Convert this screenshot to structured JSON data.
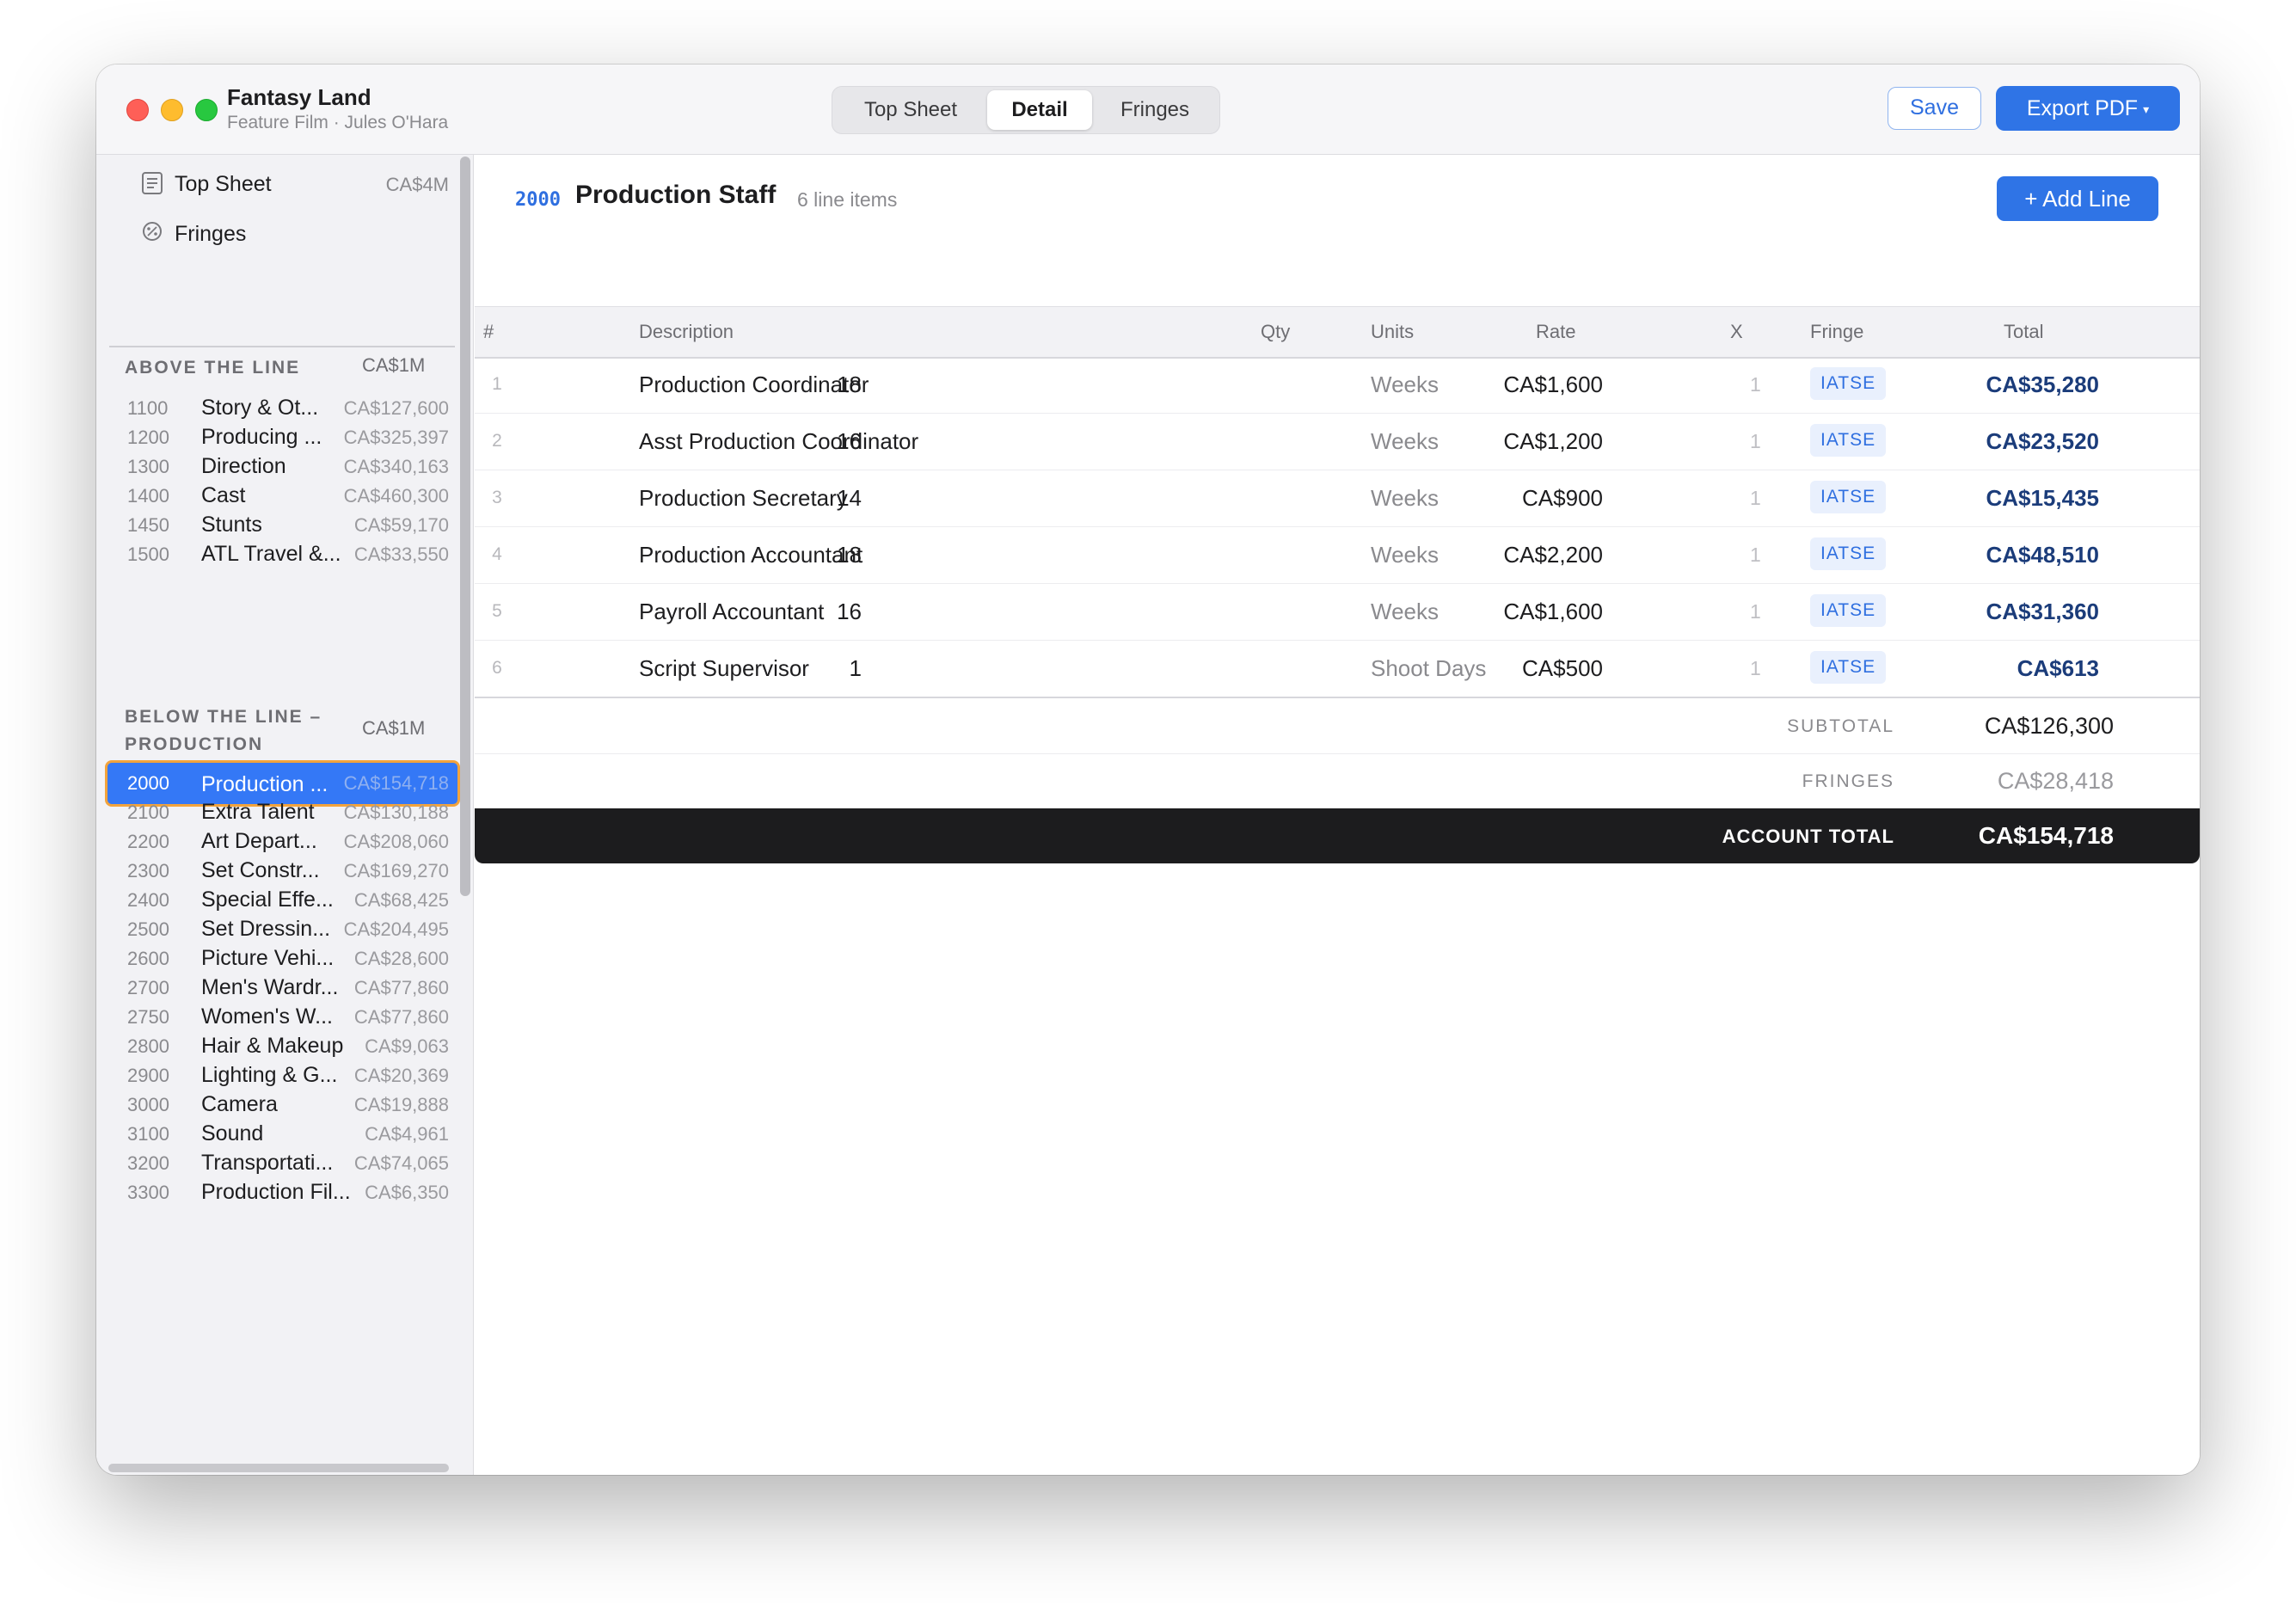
{
  "window": {
    "title": "Fantasy Land",
    "subtitle": "Feature Film · Jules O'Hara"
  },
  "tabs": [
    {
      "label": "Top Sheet",
      "active": false
    },
    {
      "label": "Detail",
      "active": true
    },
    {
      "label": "Fringes",
      "active": false
    }
  ],
  "toolbar": {
    "save_label": "Save",
    "export_label": "Export PDF",
    "export_caret": "▾"
  },
  "sidebar": {
    "nav": [
      {
        "label": "Top Sheet",
        "amount": "CA$4M",
        "icon": "document-icon"
      },
      {
        "label": "Fringes",
        "amount": "",
        "icon": "percent-icon"
      }
    ],
    "sections": [
      {
        "title": "ABOVE THE LINE",
        "amount": "CA$1M",
        "accounts": [
          {
            "code": "1100",
            "name": "Story & Ot...",
            "amount": "CA$127,600"
          },
          {
            "code": "1200",
            "name": "Producing ...",
            "amount": "CA$325,397"
          },
          {
            "code": "1300",
            "name": "Direction",
            "amount": "CA$340,163"
          },
          {
            "code": "1400",
            "name": "Cast",
            "amount": "CA$460,300"
          },
          {
            "code": "1450",
            "name": "Stunts",
            "amount": "CA$59,170"
          },
          {
            "code": "1500",
            "name": "ATL Travel &...",
            "amount": "CA$33,550"
          }
        ]
      },
      {
        "title": "BELOW THE LINE – PRODUCTION",
        "amount": "CA$1M",
        "accounts": [
          {
            "code": "2000",
            "name": "Production ...",
            "amount": "CA$154,718",
            "selected": true
          },
          {
            "code": "2100",
            "name": "Extra Talent",
            "amount": "CA$130,188"
          },
          {
            "code": "2200",
            "name": "Art Depart...",
            "amount": "CA$208,060"
          },
          {
            "code": "2300",
            "name": "Set Constr...",
            "amount": "CA$169,270"
          },
          {
            "code": "2400",
            "name": "Special Effe...",
            "amount": "CA$68,425"
          },
          {
            "code": "2500",
            "name": "Set Dressin...",
            "amount": "CA$204,495"
          },
          {
            "code": "2600",
            "name": "Picture Vehi...",
            "amount": "CA$28,600"
          },
          {
            "code": "2700",
            "name": "Men's Wardr...",
            "amount": "CA$77,860"
          },
          {
            "code": "2750",
            "name": "Women's W...",
            "amount": "CA$77,860"
          },
          {
            "code": "2800",
            "name": "Hair & Makeup",
            "amount": "CA$9,063"
          },
          {
            "code": "2900",
            "name": "Lighting & G...",
            "amount": "CA$20,369"
          },
          {
            "code": "3000",
            "name": "Camera",
            "amount": "CA$19,888"
          },
          {
            "code": "3100",
            "name": "Sound",
            "amount": "CA$4,961"
          },
          {
            "code": "3200",
            "name": "Transportati...",
            "amount": "CA$74,065"
          },
          {
            "code": "3300",
            "name": "Production Fil...",
            "amount": "CA$6,350"
          }
        ]
      }
    ]
  },
  "detail": {
    "code": "2000",
    "title": "Production Staff",
    "count": "6 line items",
    "add_label": "+ Add Line",
    "columns": [
      "#",
      "Description",
      "Qty",
      "Units",
      "Rate",
      "X",
      "Fringe",
      "Total"
    ],
    "rows": [
      {
        "num": "1",
        "desc": "Production Coordinator",
        "qty": "18",
        "units": "Weeks",
        "rate": "CA$1,600",
        "x": "1",
        "fringe": "IATSE",
        "total": "CA$35,280"
      },
      {
        "num": "2",
        "desc": "Asst Production Coordinator",
        "qty": "16",
        "units": "Weeks",
        "rate": "CA$1,200",
        "x": "1",
        "fringe": "IATSE",
        "total": "CA$23,520"
      },
      {
        "num": "3",
        "desc": "Production Secretary",
        "qty": "14",
        "units": "Weeks",
        "rate": "CA$900",
        "x": "1",
        "fringe": "IATSE",
        "total": "CA$15,435"
      },
      {
        "num": "4",
        "desc": "Production Accountant",
        "qty": "18",
        "units": "Weeks",
        "rate": "CA$2,200",
        "x": "1",
        "fringe": "IATSE",
        "total": "CA$48,510"
      },
      {
        "num": "5",
        "desc": "Payroll Accountant",
        "qty": "16",
        "units": "Weeks",
        "rate": "CA$1,600",
        "x": "1",
        "fringe": "IATSE",
        "total": "CA$31,360"
      },
      {
        "num": "6",
        "desc": "Script Supervisor",
        "qty": "1",
        "units": "Shoot Days",
        "rate": "CA$500",
        "x": "1",
        "fringe": "IATSE",
        "total": "CA$613"
      }
    ],
    "subtotal_label": "SUBTOTAL",
    "subtotal": "CA$126,300",
    "fringes_label": "FRINGES",
    "fringes": "CA$28,418",
    "grand_label": "ACCOUNT TOTAL",
    "grand_total": "CA$154,718"
  },
  "colors": {
    "accent": "#2f74e6",
    "selection": "#3478f6",
    "selection_border": "#f2a33c",
    "total_text": "#1b3c7a",
    "grand_bar": "#1c1c1e"
  }
}
